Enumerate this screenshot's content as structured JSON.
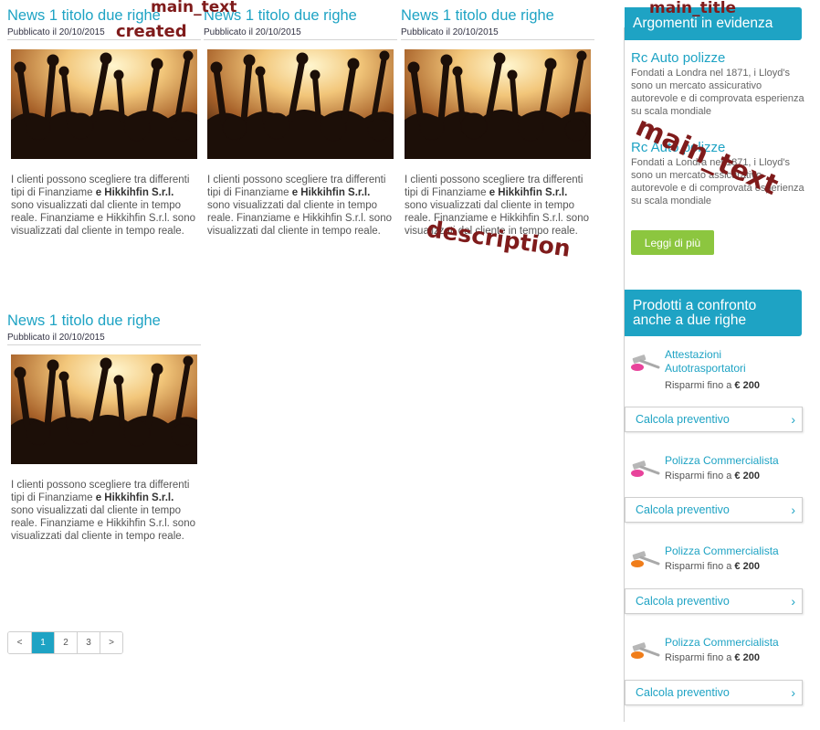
{
  "news": [
    {
      "title": "News 1 titolo due righe",
      "date": "Pubblicato il 20/10/2015",
      "desc_a": "I clienti possono scegliere tra differenti tipi di Finanziame",
      "desc_b": "e Hikkihfin S.r.l.",
      "desc_c": "sono visualizzati dal cliente in tempo reale. Finanziame e Hikkihfin S.r.l. sono visualizzati dal cliente in tempo reale."
    },
    {
      "title": "News 1 titolo due righe",
      "date": "Pubblicato il 20/10/2015",
      "desc_a": "I clienti possono scegliere tra differenti tipi di Finanziame",
      "desc_b": "e Hikkihfin S.r.l.",
      "desc_c": "sono visualizzati dal cliente in tempo reale. Finanziame e Hikkihfin S.r.l. sono visualizzati dal cliente in tempo reale."
    },
    {
      "title": "News 1 titolo due righe",
      "date": "Pubblicato il 20/10/2015",
      "desc_a": "I clienti possono scegliere tra differenti tipi di Finanziame",
      "desc_b": "e Hikkihfin S.r.l.",
      "desc_c": "sono visualizzati dal cliente in tempo reale. Finanziame e Hikkihfin S.r.l. sono visualizzati dal cliente in tempo reale."
    },
    {
      "title": "News 1 titolo due righe",
      "date": "Pubblicato il 20/10/2015",
      "desc_a": "I clienti possono scegliere tra differenti tipi di Finanziame",
      "desc_b": "e Hikkihfin S.r.l.",
      "desc_c": "sono visualizzati dal cliente in tempo reale. Finanziame e Hikkihfin S.r.l. sono visualizzati dal cliente in tempo reale."
    }
  ],
  "pagination": {
    "prev": "<",
    "pages": [
      "1",
      "2",
      "3"
    ],
    "next": ">",
    "current": "1"
  },
  "sidebar": {
    "topics_header": "Argomenti in evidenza",
    "topics": [
      {
        "title": "Rc Auto polizze",
        "text": "Fondati a Londra nel 1871, i Lloyd's sono un mercato assicurativo autorevole e di comprovata esperienza su scala mondiale"
      },
      {
        "title": "Rc Auto polizze",
        "text": "Fondati a Londra nel 1871, i Lloyd's sono un mercato assicurativo autorevole e di comprovata esperienza su scala mondiale"
      }
    ],
    "more_button": "Leggi di più",
    "products_header": "Prodotti a confronto anche a due righe",
    "products": [
      {
        "name": "Attestazioni Autotrasportatori",
        "save_prefix": "Risparmi fino a",
        "save_amount": "€ 200",
        "cta": "Calcola preventivo",
        "chevron": "›",
        "icon": "gavel-icon",
        "accent": "#e8439b"
      },
      {
        "name": "Polizza Commercialista",
        "save_prefix": "Risparmi fino a",
        "save_amount": "€ 200",
        "cta": "Calcola preventivo",
        "chevron": "›",
        "icon": "gavel-icon",
        "accent": "#e8439b"
      },
      {
        "name": "Polizza Commercialista",
        "save_prefix": "Risparmi fino a",
        "save_amount": "€ 200",
        "cta": "Calcola preventivo",
        "chevron": "›",
        "icon": "gavel-icon",
        "accent": "#f07d1a"
      },
      {
        "name": "Polizza Commercialista",
        "save_prefix": "Risparmi fino a",
        "save_amount": "€ 200",
        "cta": "Calcola preventivo",
        "chevron": "›",
        "icon": "gavel-icon",
        "accent": "#f07d1a"
      }
    ]
  },
  "annotations": {
    "main_text_top": "main_text",
    "created": "created",
    "main_title": "main_title",
    "main_text_side": "main_text",
    "description": "description"
  },
  "colors": {
    "accent": "#1ea3c4",
    "button_green": "#8cc63f",
    "annotation": "#7f1b1b"
  }
}
